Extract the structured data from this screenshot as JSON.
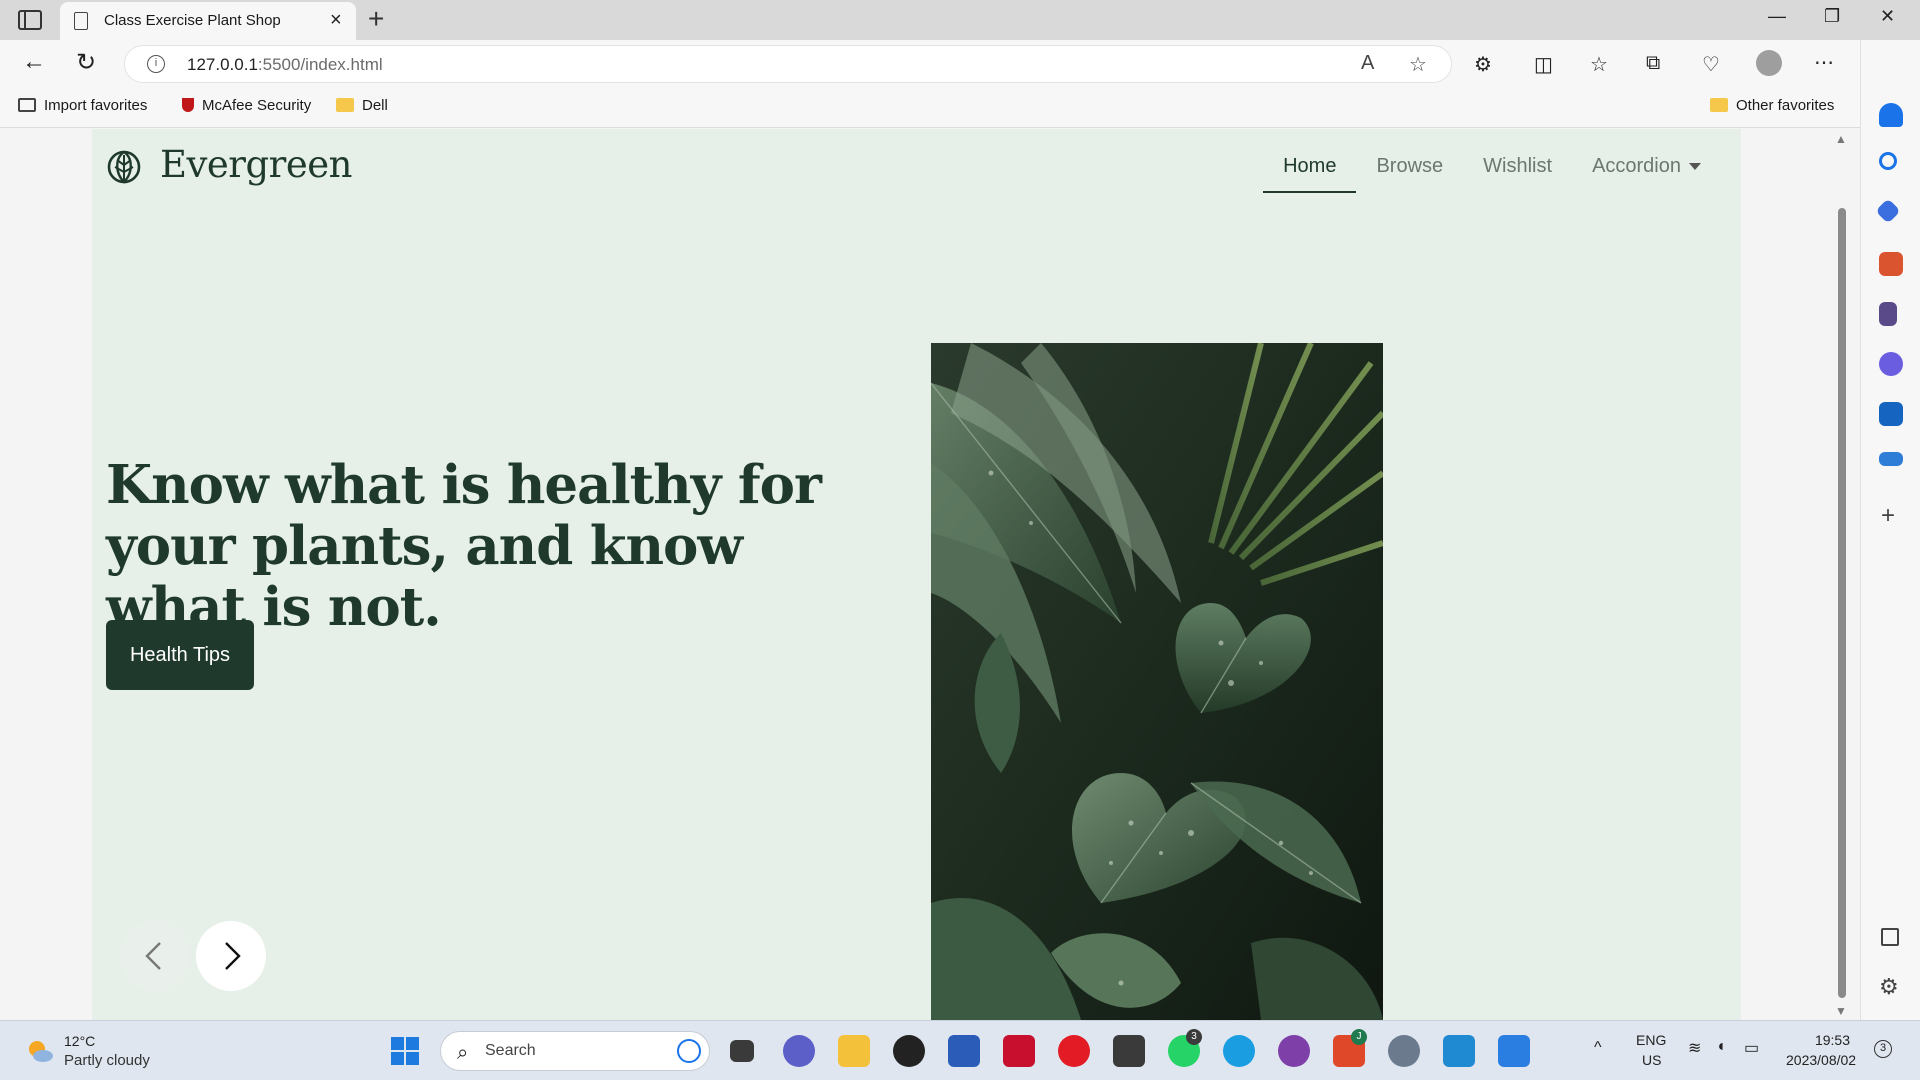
{
  "browser": {
    "tab_title": "Class Exercise Plant Shop",
    "url_host": "127.0.0.1",
    "url_rest": ":5500/index.html",
    "favorites": [
      {
        "label": "Import favorites",
        "icon": "import-icon"
      },
      {
        "label": "McAfee Security",
        "icon": "mcafee-icon"
      },
      {
        "label": "Dell",
        "icon": "folder-icon"
      }
    ],
    "other_favorites": "Other favorites"
  },
  "site": {
    "brand": "Evergreen",
    "nav": [
      {
        "label": "Home",
        "active": true
      },
      {
        "label": "Browse",
        "active": false
      },
      {
        "label": "Wishlist",
        "active": false
      },
      {
        "label": "Accordion",
        "active": false
      }
    ],
    "headline": "Know what is healthy for your plants, and know what is not.",
    "cta": "Health Tips",
    "colors": {
      "background": "#e6f0e8",
      "primary": "#1f3a2c"
    }
  },
  "taskbar": {
    "weather_temp": "12°C",
    "weather_desc": "Partly cloudy",
    "search_placeholder": "Search",
    "whatsapp_badge": "3",
    "app_badge_j": "J",
    "lang": "ENG",
    "region": "US",
    "time": "19:53",
    "date": "2023/08/02",
    "notifications": "3"
  }
}
